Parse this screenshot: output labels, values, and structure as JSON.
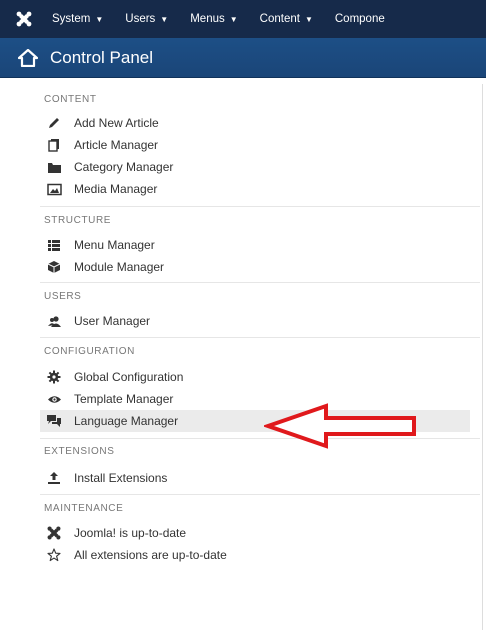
{
  "navbar": {
    "menus": [
      "System",
      "Users",
      "Menus",
      "Content",
      "Compone"
    ]
  },
  "header": {
    "title": "Control Panel"
  },
  "sidebar": {
    "sections": [
      {
        "title": "CONTENT",
        "items": [
          {
            "label": "Add New Article",
            "icon": "pencil-icon"
          },
          {
            "label": "Article Manager",
            "icon": "stack-icon"
          },
          {
            "label": "Category Manager",
            "icon": "folder-icon"
          },
          {
            "label": "Media Manager",
            "icon": "image-icon"
          }
        ]
      },
      {
        "title": "STRUCTURE",
        "items": [
          {
            "label": "Menu Manager",
            "icon": "list-icon"
          },
          {
            "label": "Module Manager",
            "icon": "cube-icon"
          }
        ]
      },
      {
        "title": "USERS",
        "items": [
          {
            "label": "User Manager",
            "icon": "users-icon"
          }
        ]
      },
      {
        "title": "CONFIGURATION",
        "items": [
          {
            "label": "Global Configuration",
            "icon": "cog-icon"
          },
          {
            "label": "Template Manager",
            "icon": "eye-icon"
          },
          {
            "label": "Language Manager",
            "icon": "comments-icon",
            "active": true
          }
        ]
      },
      {
        "title": "EXTENSIONS",
        "items": [
          {
            "label": "Install Extensions",
            "icon": "upload-icon"
          }
        ]
      },
      {
        "title": "MAINTENANCE",
        "items": [
          {
            "label": "Joomla! is up-to-date",
            "icon": "joomla-icon"
          },
          {
            "label": "All extensions are up-to-date",
            "icon": "star-icon"
          }
        ]
      }
    ]
  },
  "colors": {
    "navbar": "#162a4a",
    "header": "#1d4f86",
    "arrow": "#e0191c",
    "active_row": "#ebebeb"
  }
}
